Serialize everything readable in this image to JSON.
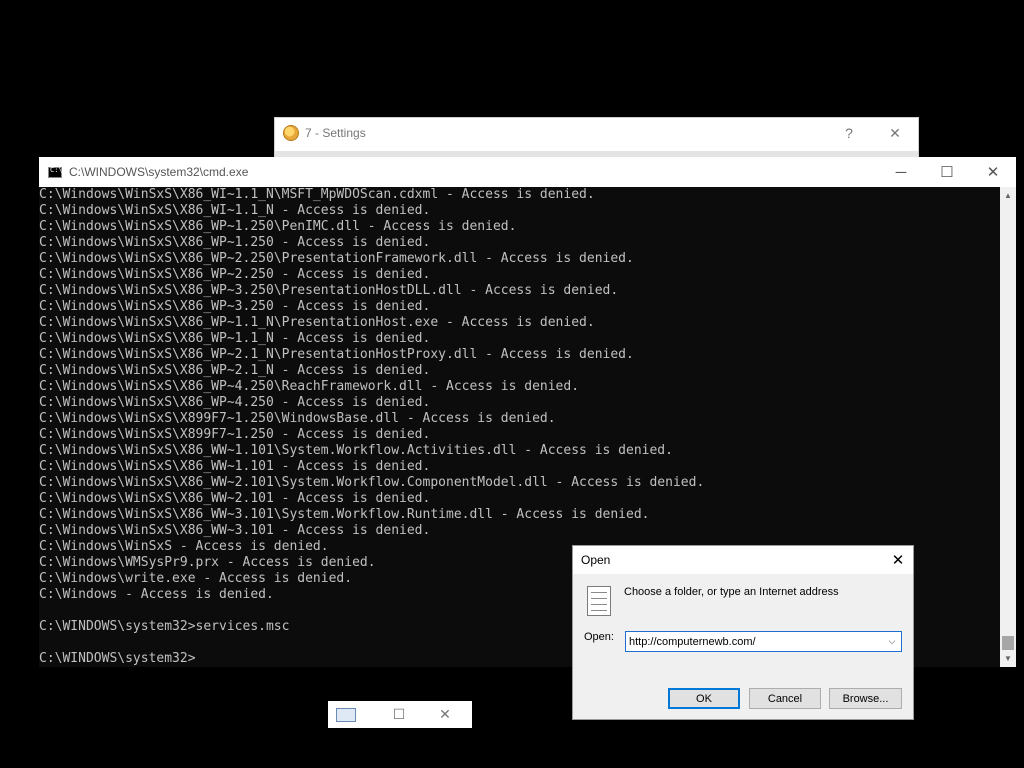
{
  "settings_window": {
    "title": "7 - Settings",
    "help_glyph": "?",
    "close_glyph": "✕"
  },
  "cmd_window": {
    "title": "C:\\WINDOWS\\system32\\cmd.exe",
    "minimize_glyph": "─",
    "maximize_glyph": "☐",
    "close_glyph": "✕",
    "output": [
      "C:\\Windows\\WinSxS\\X86_WI~1.1_N\\MSFT_MpWDOScan.cdxml - Access is denied.",
      "C:\\Windows\\WinSxS\\X86_WI~1.1_N - Access is denied.",
      "C:\\Windows\\WinSxS\\X86_WP~1.250\\PenIMC.dll - Access is denied.",
      "C:\\Windows\\WinSxS\\X86_WP~1.250 - Access is denied.",
      "C:\\Windows\\WinSxS\\X86_WP~2.250\\PresentationFramework.dll - Access is denied.",
      "C:\\Windows\\WinSxS\\X86_WP~2.250 - Access is denied.",
      "C:\\Windows\\WinSxS\\X86_WP~3.250\\PresentationHostDLL.dll - Access is denied.",
      "C:\\Windows\\WinSxS\\X86_WP~3.250 - Access is denied.",
      "C:\\Windows\\WinSxS\\X86_WP~1.1_N\\PresentationHost.exe - Access is denied.",
      "C:\\Windows\\WinSxS\\X86_WP~1.1_N - Access is denied.",
      "C:\\Windows\\WinSxS\\X86_WP~2.1_N\\PresentationHostProxy.dll - Access is denied.",
      "C:\\Windows\\WinSxS\\X86_WP~2.1_N - Access is denied.",
      "C:\\Windows\\WinSxS\\X86_WP~4.250\\ReachFramework.dll - Access is denied.",
      "C:\\Windows\\WinSxS\\X86_WP~4.250 - Access is denied.",
      "C:\\Windows\\WinSxS\\X899F7~1.250\\WindowsBase.dll - Access is denied.",
      "C:\\Windows\\WinSxS\\X899F7~1.250 - Access is denied.",
      "C:\\Windows\\WinSxS\\X86_WW~1.101\\System.Workflow.Activities.dll - Access is denied.",
      "C:\\Windows\\WinSxS\\X86_WW~1.101 - Access is denied.",
      "C:\\Windows\\WinSxS\\X86_WW~2.101\\System.Workflow.ComponentModel.dll - Access is denied.",
      "C:\\Windows\\WinSxS\\X86_WW~2.101 - Access is denied.",
      "C:\\Windows\\WinSxS\\X86_WW~3.101\\System.Workflow.Runtime.dll - Access is denied.",
      "C:\\Windows\\WinSxS\\X86_WW~3.101 - Access is denied.",
      "C:\\Windows\\WinSxS - Access is denied.",
      "C:\\Windows\\WMSysPr9.prx - Access is denied.",
      "C:\\Windows\\write.exe - Access is denied.",
      "C:\\Windows - Access is denied.",
      "",
      "C:\\WINDOWS\\system32>services.msc",
      "",
      "C:\\WINDOWS\\system32>"
    ]
  },
  "mini_window": {
    "maximize_glyph": "☐",
    "close_glyph": "✕"
  },
  "run_dialog": {
    "title": "Open",
    "close_glyph": "✕",
    "description": "Choose a folder, or type an Internet address",
    "open_label": "Open:",
    "open_value": "http://computernewb.com/",
    "dropdown_glyph": "⌵",
    "ok_label": "OK",
    "cancel_label": "Cancel",
    "browse_label": "Browse..."
  }
}
